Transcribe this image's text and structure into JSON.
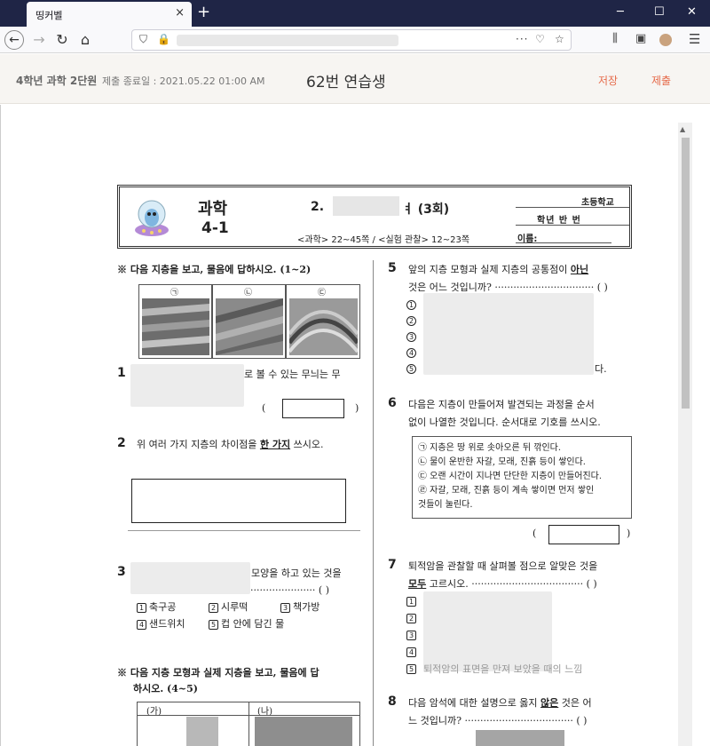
{
  "browser": {
    "tab_title": "띵커벨",
    "close_glyph": "×",
    "newtab_glyph": "+",
    "win_min": "─",
    "win_max": "☐",
    "win_close": "✕"
  },
  "header": {
    "subject": "4학년 과학 2단원",
    "deadline": "제출 종료일 : 2021.05.22 01:00 AM",
    "student": "62번 연습생",
    "save_label": "저장",
    "submit_label": "제출"
  },
  "worksheet": {
    "subject": "과학",
    "grade": "4-1",
    "unit_prefix": "2.",
    "unit_suffix": "ㅕ (3회)",
    "pages": "<과학> 22~45쪽 / <실험 관찰> 12~23쪽",
    "school": "초등학교",
    "class_line": "학년    반    번",
    "name_label": "이름:"
  },
  "questions": {
    "intro1": "※  다음 지층을 보고, 물음에 답하시오. (1~2)",
    "img_labels": [
      "㉠",
      "㉡",
      "㉢"
    ],
    "q1_num": "1",
    "q1_text": "로 볼 수 있는 무늬는 무",
    "q2_num": "2",
    "q2_text_a": "위 여러 가지 지층의 차이점을",
    "q2_emph": "한 가지",
    "q2_text_b": "쓰시오.",
    "q3_num": "3",
    "q3_text": "모양을 하고 있는 것을",
    "q3_options": [
      "축구공",
      "시루떡",
      "책가방",
      "샌드위치",
      "컵 안에 담긴 물"
    ],
    "q3_option_marks": [
      "1",
      "2",
      "3",
      "4",
      "5"
    ],
    "intro2_a": "※  다음 지층 모형과 실제 지층을 보고, 물음에 답",
    "intro2_b": "하시오. (4~5)",
    "table_labels": [
      "(가)",
      "(나)"
    ],
    "q5_num": "5",
    "q5_text_a": "앞의 지층 모형과 실제 지층의 공통점이",
    "q5_emph": "아닌",
    "q5_text_b": "것은 어느 것입니까? ································ (        )",
    "q5_tail": "다.",
    "q6_num": "6",
    "q6_text_a": "다음은 지층이 만들어져 발견되는 과정을 순서",
    "q6_text_b": "없이 나열한 것입니다. 순서대로 기호를 쓰시오.",
    "q6_items": [
      "㉠ 지층은 땅 위로 솟아오른 뒤 깎인다.",
      "㉡ 물이 운반한 자갈, 모래, 진흙 등이 쌓인다.",
      "㉢ 오랜 시간이 지나면 단단한 지층이 만들어진다.",
      "㉣ 자갈, 모래, 진흙 등이 계속 쌓이면 먼저 쌓인",
      "것들이 눌린다."
    ],
    "q7_num": "7",
    "q7_text_a": "퇴적암을 관찰할 때 살펴볼 점으로 알맞은 것을",
    "q7_emph": "모두",
    "q7_text_b": "고르시오. ···································· (        )",
    "q7_tail": "퇴적암의 표면을 만져 보았을 때의 느낌",
    "q8_num": "8",
    "q8_text_a": "다음 암석에 대한 설명으로 옳지",
    "q8_emph": "않은",
    "q8_text_b": "것은 어",
    "q8_text_c": "느 것입니까? ··································· (        )",
    "dots_paren": "····················· (        )",
    "paren_open": "(",
    "paren_close": ")"
  }
}
